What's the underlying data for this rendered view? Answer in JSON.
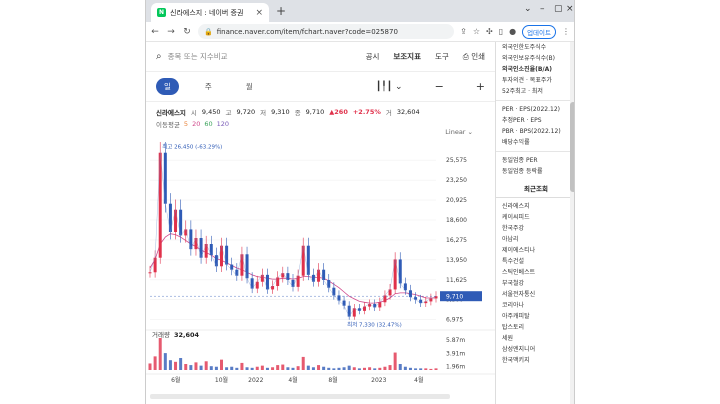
{
  "browser": {
    "tab_title": "신라에스지 : 네이버 증권",
    "favicon_letter": "N",
    "url": "finance.naver.com/item/fchart.naver?code=025870",
    "update_label": "업데이트"
  },
  "toolbar": {
    "search_placeholder": "종목 또는 지수비교",
    "links": [
      "공시",
      "보조지표",
      "도구",
      "인쇄"
    ]
  },
  "periods": [
    "일",
    "주",
    "월"
  ],
  "active_period": "일",
  "info": {
    "name": "신라에스지",
    "open_label": "시",
    "open": "9,450",
    "high_label": "고",
    "high": "9,720",
    "low_label": "저",
    "low": "9,310",
    "close_label": "종",
    "close": "9,710",
    "change": "▲260",
    "change_pct": "+2.75%",
    "volume_label": "거",
    "volume": "32,604"
  },
  "ma": {
    "label": "이동평균",
    "ma5": "5",
    "ma20": "20",
    "ma60": "60",
    "ma120": "120"
  },
  "scale_label": "Linear",
  "chart_data": {
    "type": "line",
    "price_axis": [
      "25,575",
      "23,250",
      "20,925",
      "18,600",
      "16,275",
      "13,950",
      "11,625",
      "9,300",
      "6,975"
    ],
    "volume_axis": [
      "5.87m",
      "3.91m",
      "1.96m"
    ],
    "x_labels": [
      "6월",
      "10월",
      "2022",
      "4월",
      "8월",
      "2023",
      "4월"
    ],
    "high_annotation": "최고 26,450 (-63.29%)",
    "low_annotation": "최저 7,330 (32.47%)",
    "current_price": "9,710",
    "volume_title": "거래량",
    "volume_value": "32,604",
    "price_series": [
      12500,
      14200,
      26450,
      20500,
      17200,
      19800,
      16800,
      17500,
      15200,
      16500,
      14200,
      15800,
      14500,
      13200,
      15600,
      13400,
      12800,
      12100,
      14600,
      11800,
      10600,
      11400,
      12200,
      10500,
      10900,
      11900,
      12400,
      11600,
      10800,
      12100,
      15600,
      12200,
      11400,
      12800,
      11600,
      10700,
      9800,
      9200,
      8600,
      7330,
      8300,
      8000,
      8500,
      8800,
      8400,
      9000,
      9800,
      10500,
      14000,
      11200,
      10400,
      9600,
      9300,
      8900,
      9100,
      9450,
      9710
    ],
    "ma_series": [
      13000,
      14000,
      15800,
      16600,
      17000,
      16900,
      16600,
      16200,
      15800,
      15500,
      15100,
      14800,
      14500,
      14100,
      13900,
      13600,
      13300,
      13000,
      12800,
      12500,
      12200,
      12000,
      11900,
      11800,
      11700,
      11700,
      11800,
      11800,
      11700,
      11800,
      12000,
      12000,
      11900,
      11900,
      11800,
      11500,
      11100,
      10700,
      10200,
      9700,
      9400,
      9100,
      9000,
      8900,
      8900,
      9000,
      9200,
      9500,
      10000,
      10100,
      10100,
      10000,
      9900,
      9700,
      9500,
      9500,
      9500
    ],
    "volume_series": [
      1.2,
      2.5,
      5.87,
      3.1,
      1.8,
      1.5,
      2.2,
      1.1,
      0.9,
      1.4,
      0.8,
      1.6,
      0.7,
      0.6,
      1.9,
      0.5,
      0.6,
      0.4,
      1.3,
      0.5,
      0.4,
      0.6,
      0.8,
      0.4,
      0.5,
      0.9,
      1.0,
      0.5,
      0.4,
      0.7,
      2.4,
      0.8,
      0.5,
      0.9,
      0.6,
      0.4,
      0.3,
      0.4,
      0.5,
      0.8,
      0.5,
      0.3,
      0.4,
      0.5,
      0.3,
      0.4,
      0.6,
      0.9,
      3.2,
      1.1,
      0.6,
      0.4,
      0.3,
      0.3,
      0.3,
      0.2,
      0.3
    ],
    "ylim": [
      6000,
      27000
    ]
  },
  "sidebar": {
    "top_items": [
      "외국인한도주식수",
      "외국인보유주식수(B)",
      "외국인소진율(B/A)",
      "투자의견 · 목표주가",
      "52주최고 · 최저"
    ],
    "ratio_items": [
      "PER · EPS(2022.12)",
      "추정PER · EPS",
      "PBR · BPS(2022.12)",
      "배당수익률"
    ],
    "industry_items": [
      "동일업종 PER",
      "동일업종 등락률"
    ],
    "recent_title": "최근조회",
    "recent_items": [
      "신라에스지",
      "케이씨피드",
      "한국주강",
      "아남리",
      "제이에스티나",
      "특수건설",
      "스틱인베스트",
      "부국철강",
      "서울전자통신",
      "코리아나",
      "아주캐피탈",
      "탑스토리",
      "세원",
      "삼성엔지니어",
      "한국맥키지"
    ]
  },
  "colors": {
    "accent": "#2f5bb6",
    "up": "#e0314b",
    "down": "#2f5bb6"
  }
}
